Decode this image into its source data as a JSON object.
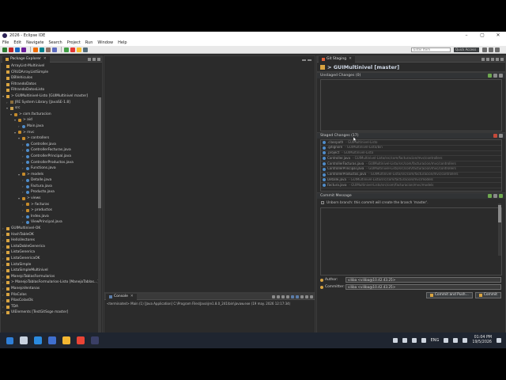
{
  "window": {
    "title": "2026 - Eclipse IDE",
    "controls": [
      "–",
      "▢",
      "✕"
    ]
  },
  "menu": [
    "File",
    "Edit",
    "Navigate",
    "Search",
    "Project",
    "Run",
    "Window",
    "Help"
  ],
  "toolbar": {
    "search_placeholder": "Enter Item",
    "quick_access": "Quick Access"
  },
  "package_explorer": {
    "tab_label": "Package Explorer",
    "items": [
      {
        "label": "ArrayList-Multinivel",
        "depth": 0,
        "icon": "prj"
      },
      {
        "label": "CRUDArrayListSimple",
        "depth": 0,
        "icon": "prj"
      },
      {
        "label": "DBVehiculos",
        "depth": 0,
        "icon": "prj"
      },
      {
        "label": "FiltrandoDatos",
        "depth": 0,
        "icon": "prj"
      },
      {
        "label": "FiltrandoDatosListo",
        "depth": 0,
        "icon": "prj"
      },
      {
        "label": "> GUIMultinivel-Listo [GUIMultinivel master]",
        "depth": 0,
        "icon": "prj",
        "arrow": "▾"
      },
      {
        "label": "JRE System Library [JavaSE-1.8]",
        "depth": 1,
        "icon": "lib",
        "arrow": "›"
      },
      {
        "label": "src",
        "depth": 1,
        "icon": "fold",
        "arrow": "▾"
      },
      {
        "label": "> com.facturacion",
        "depth": 2,
        "icon": "pkg",
        "arrow": "▾"
      },
      {
        "label": "> aid",
        "depth": 3,
        "icon": "pkg",
        "arrow": "▾"
      },
      {
        "label": "Main.java",
        "depth": 4,
        "icon": "java",
        "arrow": "›"
      },
      {
        "label": "> mvc",
        "depth": 3,
        "icon": "pkg",
        "arrow": "▾"
      },
      {
        "label": "> controllers",
        "depth": 4,
        "icon": "pkg",
        "arrow": "▾"
      },
      {
        "label": "Controller.java",
        "depth": 5,
        "icon": "java",
        "arrow": "›"
      },
      {
        "label": "ControllerFacturas.java",
        "depth": 5,
        "icon": "java",
        "arrow": "›"
      },
      {
        "label": "ControllerPrincipal.java",
        "depth": 5,
        "icon": "java",
        "arrow": "›"
      },
      {
        "label": "ControllerProductos.java",
        "depth": 5,
        "icon": "java",
        "arrow": "›"
      },
      {
        "label": "Functions.java",
        "depth": 5,
        "icon": "java",
        "arrow": "›"
      },
      {
        "label": "> models",
        "depth": 4,
        "icon": "pkg",
        "arrow": "▾"
      },
      {
        "label": "Detalle.java",
        "depth": 5,
        "icon": "java",
        "arrow": "›"
      },
      {
        "label": "Factura.java",
        "depth": 5,
        "icon": "java",
        "arrow": "›"
      },
      {
        "label": "Producto.java",
        "depth": 5,
        "icon": "java",
        "arrow": "›"
      },
      {
        "label": "> views",
        "depth": 4,
        "icon": "pkg",
        "arrow": "▾"
      },
      {
        "label": "> facturas",
        "depth": 5,
        "icon": "pkg",
        "arrow": "›"
      },
      {
        "label": "> productos",
        "depth": 5,
        "icon": "pkg",
        "arrow": "›"
      },
      {
        "label": "Index.java",
        "depth": 5,
        "icon": "java",
        "arrow": "›"
      },
      {
        "label": "ViewPrincipal.java",
        "depth": 5,
        "icon": "java",
        "arrow": "›"
      },
      {
        "label": "GUIMultinivel-OK",
        "depth": 0,
        "icon": "prj",
        "arrow": "›"
      },
      {
        "label": "HashTableOK",
        "depth": 0,
        "icon": "prj",
        "arrow": "›"
      },
      {
        "label": "HelloVectores",
        "depth": 0,
        "icon": "prj",
        "arrow": "›"
      },
      {
        "label": "ListaDobleGenerica",
        "depth": 0,
        "icon": "prj",
        "arrow": "›"
      },
      {
        "label": "ListaGenerica",
        "depth": 0,
        "icon": "prj",
        "arrow": "›"
      },
      {
        "label": "ListaGenericaOK",
        "depth": 0,
        "icon": "prj",
        "arrow": "›"
      },
      {
        "label": "ListaSimple",
        "depth": 0,
        "icon": "prj",
        "arrow": "›"
      },
      {
        "label": "ListaSimpleMultinivel",
        "depth": 0,
        "icon": "prj",
        "arrow": "›"
      },
      {
        "label": "ManejoTablasFormularios",
        "depth": 0,
        "icon": "prj",
        "arrow": "›"
      },
      {
        "label": "> ManejoTablasFormularios-Listo [ManejoTablas...]",
        "depth": 0,
        "icon": "prj",
        "arrow": "›"
      },
      {
        "label": "ManejoVentanas",
        "depth": 0,
        "icon": "prj",
        "arrow": "›"
      },
      {
        "label": "PilaColas",
        "depth": 0,
        "icon": "prj",
        "arrow": "›"
      },
      {
        "label": "PilasColasOk",
        "depth": 0,
        "icon": "prj",
        "arrow": "›"
      },
      {
        "label": "TDA",
        "depth": 0,
        "icon": "prj",
        "arrow": "›"
      },
      {
        "label": "UIElements [TestGitSsge master]",
        "depth": 0,
        "icon": "prj",
        "arrow": "›"
      }
    ]
  },
  "console": {
    "tab_label": "Console",
    "line": "<terminated> Main (1) [Java Application] C:\\Program Files\\Java\\jre1.8.0_241\\bin\\javaw.exe (19 may. 2026 12:17:34)"
  },
  "git_staging": {
    "tab_label": "Git Staging",
    "repo_title": "> GUIMultinivel [master]",
    "unstaged_header": "Unstaged Changes (0)",
    "staged_header": "Staged Changes (17)",
    "staged_items": [
      {
        "name": ".classpath",
        "path": "- GUIMultinivel-Listo"
      },
      {
        "name": ".gitignore",
        "path": "- GUIMultinivel-Listo/bin"
      },
      {
        "name": ".project",
        "path": "- GUIMultinivel-Listo"
      },
      {
        "name": "Controller.java",
        "path": "- GUIMultinivel-Listo/src/com/facturacion/mvc/controllers"
      },
      {
        "name": "ControllerFacturas.java",
        "path": "- GUIMultinivel-Listo/src/com/facturacion/mvc/controllers"
      },
      {
        "name": "ControllerPrincipal.java",
        "path": "- GUIMultinivel-Listo/src/com/facturacion/mvc/controllers"
      },
      {
        "name": "ControllerProductos.java",
        "path": "- GUIMultinivel-Listo/src/com/facturacion/mvc/controllers"
      },
      {
        "name": "Detalle.java",
        "path": "- GUIMultinivel-Listo/src/com/facturacion/mvc/models"
      },
      {
        "name": "Factura.java",
        "path": "- GUIMultinivel-Listo/src/com/facturacion/mvc/models"
      }
    ],
    "commit_header": "Commit Message",
    "unborn_text": "Unborn branch: this commit will create the branch 'master'.",
    "author_label": "Author:",
    "author_value": "viliba <viliba@10.42.43.25>",
    "committer_label": "Committer:",
    "committer_value": "viliba <viliba@10.42.43.25>",
    "commit_push_label": "Commit and Push...",
    "commit_label": "Commit"
  },
  "taskbar": {
    "lang": "ENG",
    "time": "01:04 PM",
    "date": "19/5/2026"
  },
  "colors": {
    "toolbar_icons": [
      "#2e7d32",
      "#c62828",
      "#1565c0",
      "#6a1b9a",
      "#ef6c00",
      "#00838f",
      "#8d6e63",
      "#5c6bc0",
      "#43a047",
      "#e53935",
      "#fbc02d",
      "#546e7a"
    ],
    "taskbar_icons": [
      "#2f7fd8",
      "#c8d2e0",
      "#2b8be0",
      "#4070d0",
      "#f2b632",
      "#e94436",
      "#3a3f66"
    ]
  }
}
